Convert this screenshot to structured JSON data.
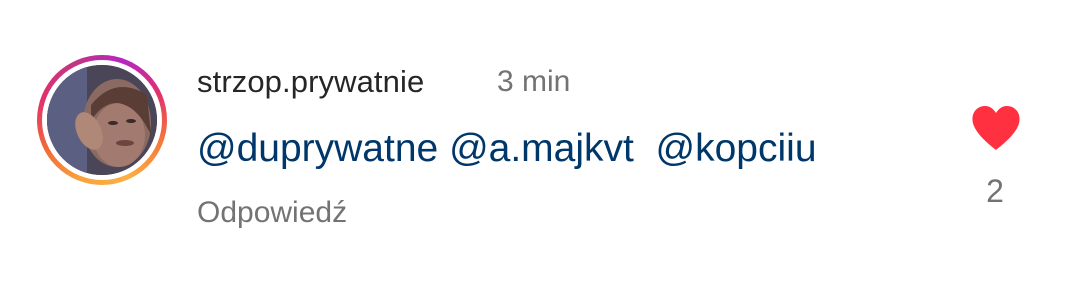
{
  "comment": {
    "username": "strzop.prywatnie",
    "time": "3 min",
    "mentions": [
      "@duprywatne",
      "@a.majkvt",
      "@kopciiu"
    ],
    "reply_label": "Odpowiedź",
    "like_count": "2",
    "like_icon": "heart-filled-icon",
    "like_color": "#ff3040"
  },
  "colors": {
    "mention": "#00376b",
    "username": "#262626",
    "secondary": "#737373"
  }
}
